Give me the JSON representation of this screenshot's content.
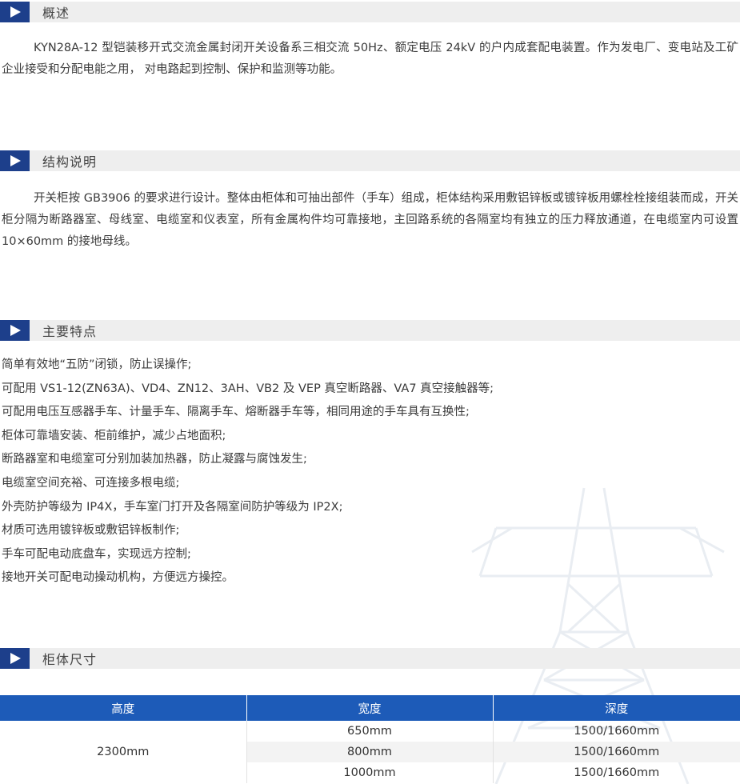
{
  "sections": [
    {
      "title": "概述"
    },
    {
      "title": "结构说明"
    },
    {
      "title": "主要特点"
    },
    {
      "title": "柜体尺寸"
    }
  ],
  "overview": {
    "text": "KYN28A-12 型铠装移开式交流金属封闭开关设备系三相交流 50Hz、额定电压 24kV 的户内成套配电装置。作为发电厂、变电站及工矿企业接受和分配电能之用， 对电路起到控制、保护和监测等功能。"
  },
  "structure": {
    "text": "开关柜按 GB3906 的要求进行设计。整体由柜体和可抽出部件（手车）组成，柜体结构采用敷铝锌板或镀锌板用螺栓栓接组装而成，开关柜分隔为断路器室、母线室、电缆室和仪表室，所有金属构件均可靠接地，主回路系统的各隔室均有独立的压力释放通道，在电缆室内可设置 10×60mm 的接地母线。"
  },
  "features": [
    "简单有效地“五防”闭锁，防止误操作;",
    "可配用 VS1-12(ZN63A)、VD4、ZN12、3AH、VB2 及 VEP 真空断路器、VA7 真空接触器等;",
    "可配用电压互感器手车、计量手车、隔离手车、熔断器手车等，相同用途的手车具有互换性;",
    "柜体可靠墙安装、柜前维护，减少占地面积;",
    "断路器室和电缆室可分别加装加热器，防止凝露与腐蚀发生;",
    "电缆室空间充裕、可连接多根电缆;",
    "外壳防护等级为 IP4X，手车室门打开及各隔室间防护等级为 IP2X;",
    "材质可选用镀锌板或敷铝锌板制作;",
    "手车可配电动底盘车，实现远方控制;",
    "接地开关可配电动操动机构，方便远方操控。"
  ],
  "dimensions": {
    "headers": [
      "高度",
      "宽度",
      "深度"
    ],
    "height": "2300mm",
    "rows": [
      {
        "width": "650mm",
        "depth": "1500/1660mm"
      },
      {
        "width": "800mm",
        "depth": "1500/1660mm"
      },
      {
        "width": "1000mm",
        "depth": "1500/1660mm"
      }
    ]
  },
  "colors": {
    "section_icon": "#1d3f8b",
    "section_bar": "#eeeeee",
    "table_header": "#1d5bb8"
  },
  "icons": [
    "play-arrow-icon",
    "power-tower-watermark"
  ]
}
